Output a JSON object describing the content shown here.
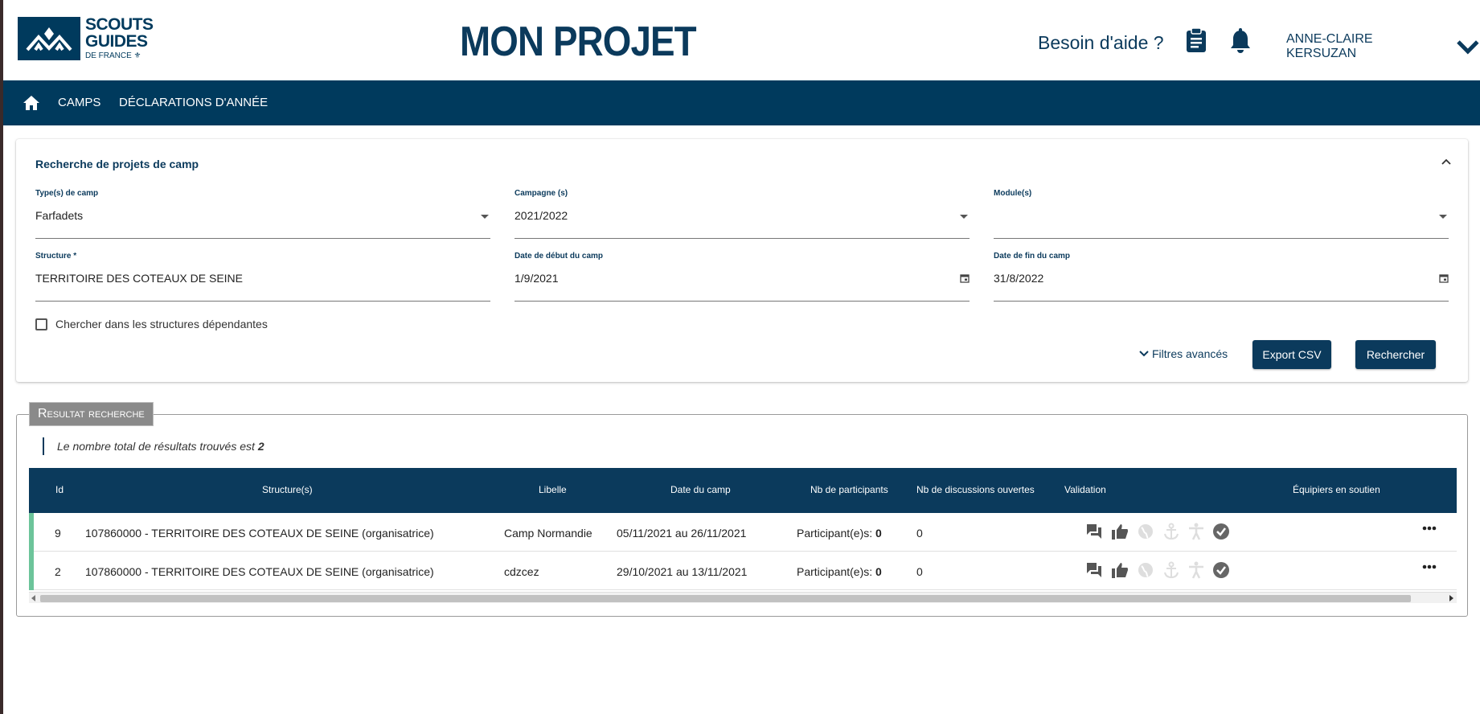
{
  "header": {
    "logo": {
      "line1": "SCOUTS",
      "line2": "GUIDES",
      "line3": "DE FRANCE ⚜"
    },
    "title": "MON PROJET",
    "help_label": "Besoin d'aide ?",
    "user_name": "ANNE-CLAIRE KERSUZAN",
    "icons": [
      "clipboard-icon",
      "bell-icon",
      "chevron-down-icon"
    ]
  },
  "nav": {
    "items": [
      {
        "label": "CAMPS"
      },
      {
        "label": "DÉCLARATIONS D'ANNÉE"
      }
    ]
  },
  "search": {
    "title": "Recherche de projets de camp",
    "fields": {
      "type_camp": {
        "label": "Type(s) de camp",
        "value": "Farfadets"
      },
      "campagne": {
        "label": "Campagne (s)",
        "value": "2021/2022"
      },
      "module": {
        "label": "Module(s)",
        "value": ""
      },
      "structure": {
        "label": "Structure *",
        "value": "TERRITOIRE DES COTEAUX DE SEINE"
      },
      "date_debut": {
        "label": "Date de début du camp",
        "value": "1/9/2021"
      },
      "date_fin": {
        "label": "Date de fin du camp",
        "value": "31/8/2022"
      }
    },
    "checkbox_label": "Chercher dans les structures dépendantes",
    "checkbox_checked": false,
    "advanced_filters": "Filtres avancés",
    "export_button": "Export CSV",
    "search_button": "Rechercher"
  },
  "results": {
    "legend": "Resultat recherche",
    "count_text": "Le nombre total de résultats trouvés est",
    "count": "2",
    "columns": [
      "Id",
      "Structure(s)",
      "Libelle",
      "Date du camp",
      "Nb de participants",
      "Nb de discussions ouvertes",
      "Validation",
      "Équipiers en soutien"
    ],
    "rows": [
      {
        "id": "9",
        "structure": "107860000 - TERRITOIRE DES COTEAUX DE SEINE (organisatrice)",
        "libelle": "Camp Normandie",
        "date": "05/11/2021 au 26/11/2021",
        "participants_label": "Participant(e)s:",
        "participants": "0",
        "discussions": "0"
      },
      {
        "id": "2",
        "structure": "107860000 - TERRITOIRE DES COTEAUX DE SEINE (organisatrice)",
        "libelle": "cdzcez",
        "date": "29/10/2021 au 13/11/2021",
        "participants_label": "Participant(e)s:",
        "participants": "0",
        "discussions": "0"
      }
    ]
  },
  "colors": {
    "primary": "#003a5d",
    "row_accent": "#6cc49a",
    "legend_bg": "#8a8a8a"
  }
}
